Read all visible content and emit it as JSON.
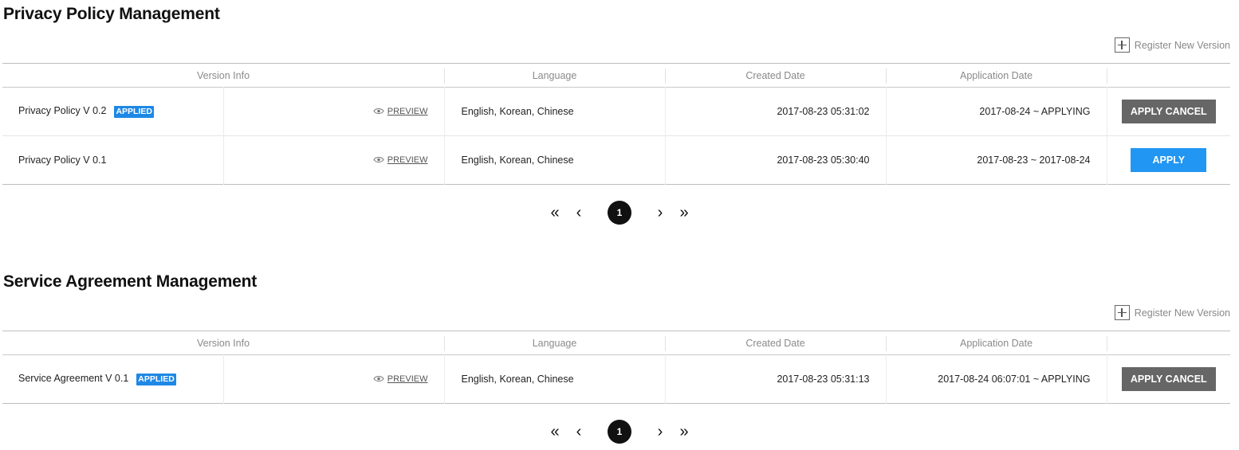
{
  "privacy": {
    "title": "Privacy Policy Management",
    "register_label": "Register New Version",
    "headers": [
      "Version Info",
      "Language",
      "Created Date",
      "Application Date"
    ],
    "rows": [
      {
        "version": "Privacy Policy V 0.2",
        "badge": "APPLIED",
        "preview": "PREVIEW",
        "language": "English, Korean, Chinese",
        "created": "2017-08-23 05:31:02",
        "application": "2017-08-24 ~ APPLYING",
        "action": "APPLY CANCEL"
      },
      {
        "version": "Privacy Policy V 0.1",
        "badge": "",
        "preview": "PREVIEW",
        "language": "English, Korean, Chinese",
        "created": "2017-08-23 05:30:40",
        "application": "2017-08-23 ~ 2017-08-24",
        "action": "APPLY"
      }
    ],
    "pagination": {
      "current": "1"
    }
  },
  "service": {
    "title": "Service Agreement Management",
    "register_label": "Register New Version",
    "headers": [
      "Version Info",
      "Language",
      "Created Date",
      "Application Date"
    ],
    "rows": [
      {
        "version": "Service Agreement V 0.1",
        "badge": "APPLIED",
        "preview": "PREVIEW",
        "language": "English, Korean, Chinese",
        "created": "2017-08-23 05:31:13",
        "application": "2017-08-24 06:07:01 ~ APPLYING",
        "action": "APPLY CANCEL"
      }
    ],
    "pagination": {
      "current": "1"
    }
  },
  "colors": {
    "badge": "#1e88e5",
    "apply": "#2196f3",
    "cancel": "#666666"
  },
  "icons": {
    "register": "plus-square-icon",
    "preview": "eye-icon",
    "first": "double-chevron-left-icon",
    "prev": "chevron-left-icon",
    "next": "chevron-right-icon",
    "last": "double-chevron-right-icon"
  }
}
